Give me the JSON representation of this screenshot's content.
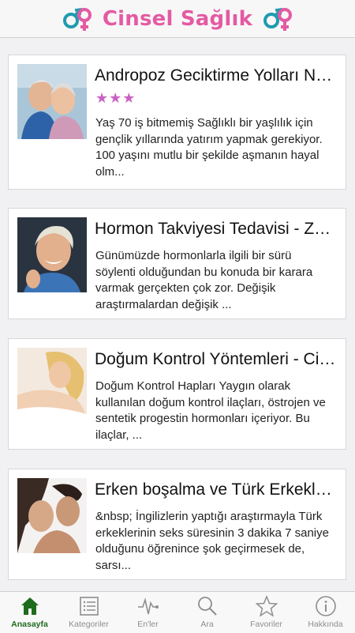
{
  "header": {
    "title": "Cinsel Sağlık",
    "left_icon": "gender-symbols-icon",
    "right_icon": "gender-symbols-icon"
  },
  "colors": {
    "brand_pink": "#e45aa3",
    "male_blue": "#1f9ab0",
    "female_pink": "#e45aa3",
    "star_purple": "#c962c2",
    "active_tab": "#1d6b1d"
  },
  "articles": [
    {
      "title": "Andropoz Geciktirme Yolları Nele...",
      "rating": "★★★",
      "description": "Yaş 70 iş bitmemiş Sağlıklı bir yaşlılık için gençlik yıllarında yatırım yapmak gerekiyor. 100 yaşını mutlu bir şekilde aşmanın hayal olm..."
    },
    {
      "title": "Hormon Takviyesi Tedavisi - Zor ...",
      "description": "Günümüzde hormonlarla ilgili bir sürü söylenti olduğundan bu konuda bir karara varmak gerçekten çok zor. Değişik araştırmalardan değişik ..."
    },
    {
      "title": "Doğum Kontrol Yöntemleri - Cins...",
      "description": "Doğum Kontrol Hapları  Yaygın olarak kullanılan doğum kontrol ilaçları, östrojen ve sentetik progestin hormonları içeriyor. Bu ilaçlar, ..."
    },
    {
      "title": "Erken boşalma ve Türk Erkekleri - E",
      "description": "&nbsp;  İngilizlerin yaptığı araştırmayla Türk erkeklerinin seks süresinin 3 dakika 7 saniye olduğunu öğrenince şok geçirmesek de, sarsı..."
    }
  ],
  "tabs": [
    {
      "label": "Anasayfa",
      "icon": "home-icon",
      "active": true
    },
    {
      "label": "Kategoriler",
      "icon": "list-icon"
    },
    {
      "label": "En'ler",
      "icon": "pulse-icon"
    },
    {
      "label": "Ara",
      "icon": "search-icon"
    },
    {
      "label": "Favoriler",
      "icon": "star-icon"
    },
    {
      "label": "Hakkında",
      "icon": "info-icon"
    }
  ]
}
